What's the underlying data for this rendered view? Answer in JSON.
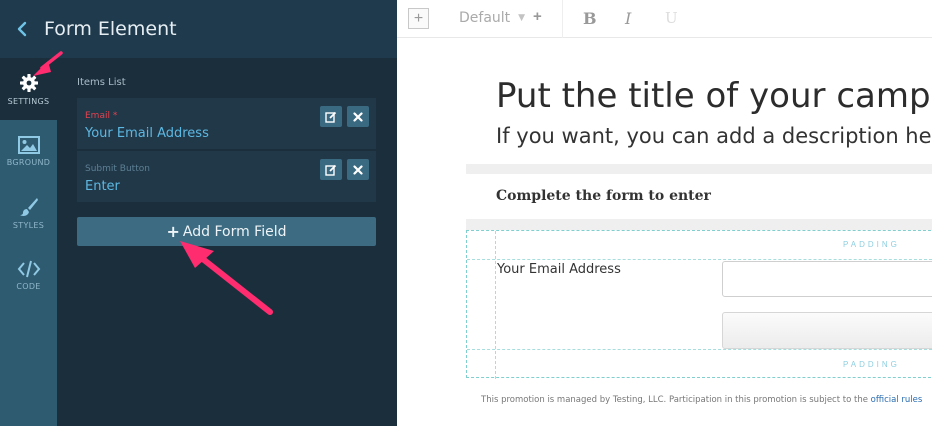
{
  "panel": {
    "title": "Form Element",
    "rail": [
      {
        "label": "SETTINGS",
        "icon": "gear-icon"
      },
      {
        "label": "BGROUND",
        "icon": "image-icon"
      },
      {
        "label": "STYLES",
        "icon": "brush-icon"
      },
      {
        "label": "CODE",
        "icon": "code-icon"
      }
    ],
    "items_heading": "Items List",
    "items": [
      {
        "label": "Email *",
        "value": "Your Email Address",
        "label_color": "#e0434f"
      },
      {
        "label": "Submit Button",
        "value": "Enter",
        "label_color": "#5d7f93"
      }
    ],
    "add_button": "Add Form Field"
  },
  "toolbar": {
    "add_symbol": "+",
    "font": "Default",
    "font_plus": "+",
    "bold": "B",
    "italic": "I",
    "underline": "U"
  },
  "canvas": {
    "title": "Put the title of your campaign here",
    "description": "If you want, you can add a description here",
    "form_heading": "Complete the form to enter",
    "padding_label": "PADDING",
    "email_label": "Your Email Address",
    "footer_text": "This promotion is managed by Testing, LLC. Participation in this promotion is subject to the ",
    "footer_link": "official rules"
  },
  "colors": {
    "panel_bg": "#1b2e3c",
    "rail_bg": "#2f5b71",
    "accent": "#5db8e2",
    "annotation_arrow": "#ff2d6f"
  }
}
